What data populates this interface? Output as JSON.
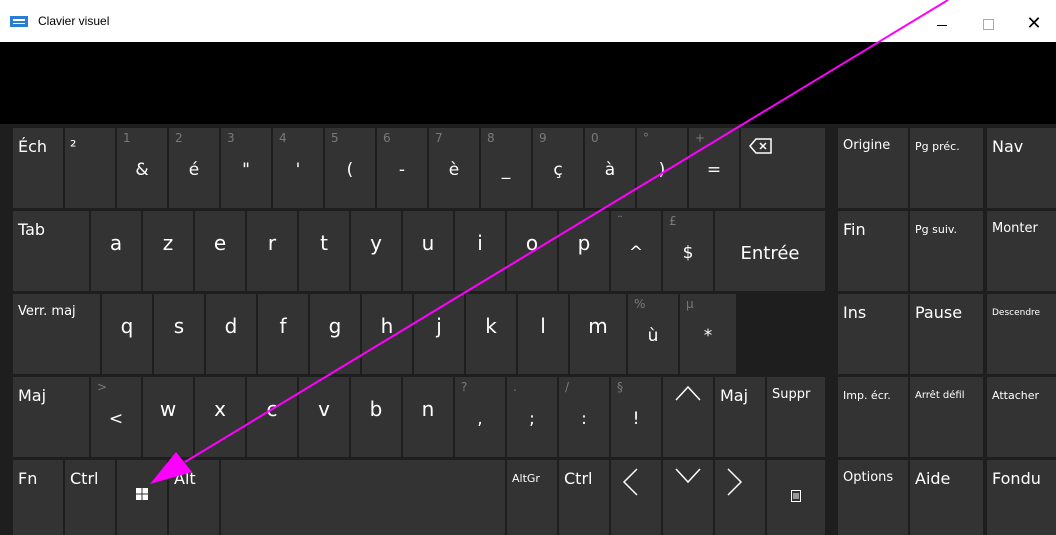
{
  "window": {
    "title": "Clavier visuel",
    "icon": "keyboard-icon",
    "controls": [
      "minimize-icon",
      "maximize-icon",
      "close-icon"
    ],
    "close_glyph": "✕"
  },
  "colors": {
    "key": "#333333",
    "background": "#1e1e1e",
    "secondary_label": "#7a7a7a",
    "annotation_arrow": "#ff00ff"
  },
  "row1": {
    "ech": "Éch",
    "sq": "²",
    "k1": {
      "sec": "1",
      "pri": "&"
    },
    "k2": {
      "sec": "2",
      "pri": "é"
    },
    "k3": {
      "sec": "3",
      "pri": "\""
    },
    "k4": {
      "sec": "4",
      "pri": "'"
    },
    "k5": {
      "sec": "5",
      "pri": "("
    },
    "k6": {
      "sec": "6",
      "pri": "-"
    },
    "k7": {
      "sec": "7",
      "pri": "è"
    },
    "k8": {
      "sec": "8",
      "pri": "_"
    },
    "k9": {
      "sec": "9",
      "pri": "ç"
    },
    "k0": {
      "sec": "0",
      "pri": "à"
    },
    "kdeg": {
      "sec": "°",
      "pri": ")"
    },
    "kplus": {
      "sec": "+",
      "pri": "="
    },
    "backspace_icon": "backspace-icon"
  },
  "row2": {
    "tab": "Tab",
    "a": "a",
    "z": "z",
    "e": "e",
    "r": "r",
    "t": "t",
    "y": "y",
    "u": "u",
    "i": "i",
    "o": "o",
    "p": "p",
    "circ": {
      "sec": "¨",
      "pri": "^"
    },
    "dollar": {
      "sec": "£",
      "pri": "$"
    },
    "enter": "Entrée"
  },
  "row3": {
    "caps": "Verr. maj",
    "q": "q",
    "s": "s",
    "d": "d",
    "f": "f",
    "g": "g",
    "h": "h",
    "j": "j",
    "k": "k",
    "l": "l",
    "m": "m",
    "ugrave": {
      "sec": "%",
      "pri": "ù"
    },
    "star": {
      "sec": "µ",
      "pri": "*"
    }
  },
  "row4": {
    "shift": "Maj",
    "lt": {
      "sec": ">",
      "pri": "<"
    },
    "w": "w",
    "x": "x",
    "c": "c",
    "v": "v",
    "b": "b",
    "n": "n",
    "comma": {
      "sec": "?",
      "pri": ","
    },
    "semicolon": {
      "sec": ".",
      "pri": ";"
    },
    "colon": {
      "sec": "/",
      "pri": ":"
    },
    "excl": {
      "sec": "§",
      "pri": "!"
    },
    "up_icon": "arrow-up-icon",
    "shift_r": "Maj",
    "del": "Suppr"
  },
  "row5": {
    "fn": "Fn",
    "ctrl": "Ctrl",
    "win_icon": "windows-icon",
    "alt": "Alt",
    "altgr": "AltGr",
    "ctrl_r": "Ctrl",
    "left_icon": "arrow-left-icon",
    "down_icon": "arrow-down-icon",
    "right_icon": "arrow-right-icon",
    "menu_icon": "context-menu-icon"
  },
  "nav": {
    "home": "Origine",
    "pgup": "Pg préc.",
    "navkey": "Nav",
    "end": "Fin",
    "pgdn": "Pg suiv.",
    "monter": "Monter",
    "ins": "Ins",
    "pause": "Pause",
    "descendre": "Descendre",
    "prtsc": "Imp. écr.",
    "scroll": "Arrêt défil",
    "attacher": "Attacher",
    "options": "Options",
    "aide": "Aide",
    "fondu": "Fondu"
  }
}
